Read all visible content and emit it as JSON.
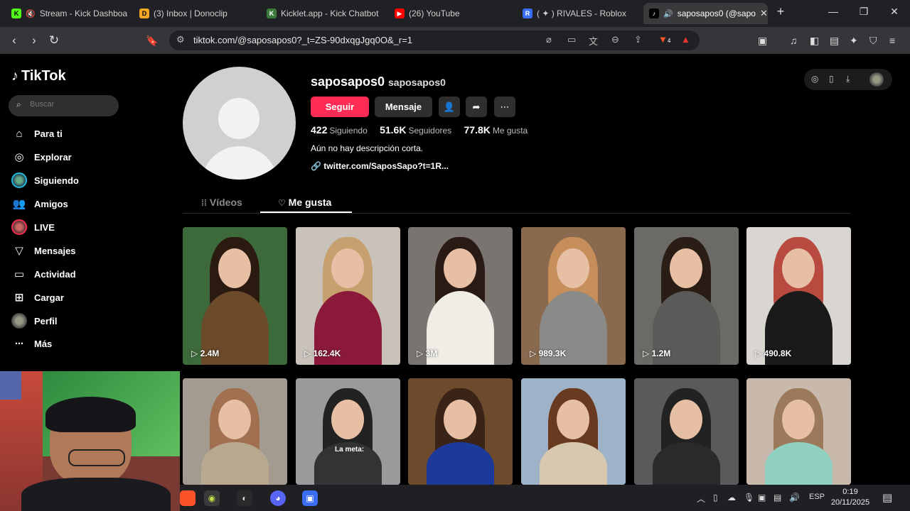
{
  "browser": {
    "tabs": [
      {
        "title": "Stream - Kick Dashboa",
        "favicon": "K",
        "color": "#53fc18"
      },
      {
        "title": "(3) Inbox | Donoclip",
        "favicon": "D",
        "color": "#f5a623"
      },
      {
        "title": "Kicklet.app - Kick Chatbot",
        "favicon": "K",
        "color": "#3b7a3b"
      },
      {
        "title": "(26) YouTube",
        "favicon": "▶",
        "color": "#ff0000"
      },
      {
        "title": "( ✦ ) RIVALES - Roblox",
        "favicon": "R",
        "color": "#3a6cf4"
      },
      {
        "title": "saposapos0 (@sapo",
        "favicon": "♪",
        "color": "#ffffff"
      }
    ],
    "new_tab": "+",
    "url": "tiktok.com/@saposapos0?_t=ZS-90dxqgJgq0O&_r=1",
    "brave_badge": "4"
  },
  "sidebar": {
    "brand": "TikTok",
    "search_placeholder": "Buscar",
    "items": [
      {
        "label": "Para ti",
        "icon": "home-icon"
      },
      {
        "label": "Explorar",
        "icon": "compass-icon"
      },
      {
        "label": "Siguiendo",
        "icon": "following-avatar"
      },
      {
        "label": "Amigos",
        "icon": "friends-icon"
      },
      {
        "label": "LIVE",
        "icon": "live-avatar"
      },
      {
        "label": "Mensajes",
        "icon": "send-icon"
      },
      {
        "label": "Actividad",
        "icon": "inbox-icon"
      },
      {
        "label": "Cargar",
        "icon": "upload-icon"
      },
      {
        "label": "Perfil",
        "icon": "profile-avatar"
      },
      {
        "label": "Más",
        "icon": "more-icon"
      }
    ]
  },
  "profile": {
    "username": "saposapos0",
    "nickname": "saposapos0",
    "follow_label": "Seguir",
    "message_label": "Mensaje",
    "following_count": "422",
    "following_label": "Siguiendo",
    "followers_count": "51.6K",
    "followers_label": "Seguidores",
    "likes_count": "77.8K",
    "likes_label": "Me gusta",
    "bio": "Aún no hay descripción corta.",
    "link": "twitter.com/SaposSapo?t=1R..."
  },
  "tabs": {
    "videos": "Vídeos",
    "likes": "Me gusta"
  },
  "videos": [
    {
      "views": "2.4M",
      "bg": "#3d6a3a"
    },
    {
      "views": "162.4K",
      "bg": "#c8c2bb"
    },
    {
      "views": "3M",
      "bg": "#7a7470"
    },
    {
      "views": "989.3K",
      "bg": "#8a6a4f"
    },
    {
      "views": "1.2M",
      "bg": "#6c6a66"
    },
    {
      "views": "490.8K",
      "bg": "#d9d6d2"
    },
    {
      "views": "",
      "bg": "#a39a90"
    },
    {
      "views": "",
      "bg": "#9a9a9a"
    },
    {
      "views": "",
      "bg": "#6e4a2c"
    },
    {
      "views": "",
      "bg": "#9fb3c8"
    },
    {
      "views": "",
      "bg": "#5a5a5a"
    },
    {
      "views": "",
      "bg": "#c9b9ad"
    }
  ],
  "grid_overlay_text": "La meta:",
  "taskbar": {
    "lang": "ESP",
    "time": "0:19",
    "date": "20/11/2025"
  }
}
